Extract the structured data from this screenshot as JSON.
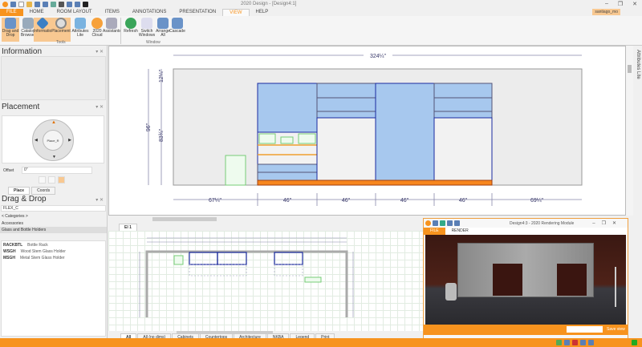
{
  "window": {
    "title": "2020 Design - [Design4:1]",
    "user": "santiago_mo"
  },
  "ribbon": {
    "tabs": [
      "FILE",
      "HOME",
      "ROOM LAYOUT",
      "ITEMS",
      "ANNOTATIONS",
      "PRESENTATION",
      "VIEW",
      "HELP"
    ],
    "tools": [
      {
        "label": "Drag and Drop",
        "selected": true
      },
      {
        "label": "Catalog Browser",
        "selected": false
      },
      {
        "label": "Information",
        "selected": true
      },
      {
        "label": "Placement",
        "selected": true
      },
      {
        "label": "Attributes Lite",
        "selected": false
      },
      {
        "label": "2020 Cloud",
        "selected": false
      },
      {
        "label": "Assistants",
        "selected": false
      }
    ],
    "window_tools": [
      "Refresh",
      "Switch Windows",
      "Arrange All",
      "Cascade"
    ],
    "groups": {
      "tools": "Tools",
      "window": "Window"
    }
  },
  "information": {
    "title": "Information"
  },
  "placement": {
    "title": "Placement",
    "dial_label": "Place_R",
    "offset_label": "Offset",
    "offset_value": "0\"",
    "tabs": [
      "Place",
      "Coords"
    ]
  },
  "dragdrop": {
    "title": "Drag & Drop",
    "catalog": "FLEX_C",
    "categories_label": "< Categories >",
    "category_items": [
      "Accessories",
      "Glass and Bottle Holders"
    ],
    "items": [
      {
        "code": "RACKBTL",
        "desc": "Bottle Rack"
      },
      {
        "code": "WSGH",
        "desc": "Wood Stem Glass Holder"
      },
      {
        "code": "MSGH",
        "desc": "Metal Stem Glass Holder"
      }
    ]
  },
  "elevation": {
    "overall_width": "324¼\"",
    "height_total": "96\"",
    "height_top": "12¼\"",
    "height_cab": "83¾\"",
    "bottom_dims": [
      "67¼\"",
      "46\"",
      "46\"",
      "46\"",
      "46\"",
      "69¼\""
    ],
    "side_tab": "Attributes Lite",
    "view_tab": "El 1"
  },
  "plan": {
    "tabs": [
      "All",
      "All (no dims)",
      "Cabinets",
      "Countertops",
      "Architecture",
      "NKBA",
      "Legend",
      "Print"
    ]
  },
  "render": {
    "title": "Design4:3 - 2020 Rendering Module",
    "tabs": [
      "FILE",
      "RENDER"
    ],
    "save_view": "Save view"
  }
}
